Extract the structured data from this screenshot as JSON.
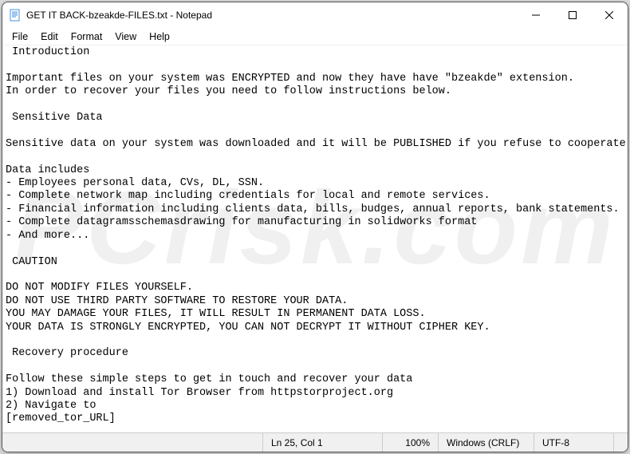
{
  "titlebar": {
    "title": "GET IT BACK-bzeakde-FILES.txt - Notepad"
  },
  "menu": {
    "file": "File",
    "edit": "Edit",
    "format": "Format",
    "view": "View",
    "help": "Help"
  },
  "content": " Introduction\n\nImportant files on your system was ENCRYPTED and now they have have \"bzeakde\" extension.\nIn order to recover your files you need to follow instructions below.\n\n Sensitive Data\n\nSensitive data on your system was downloaded and it will be PUBLISHED if you refuse to cooperate.\n\nData includes\n- Employees personal data, CVs, DL, SSN.\n- Complete network map including credentials for local and remote services.\n- Financial information including clients data, bills, budges, annual reports, bank statements.\n- Complete datagramsschemasdrawing for manufacturing in solidworks format\n- And more...\n\n CAUTION\n\nDO NOT MODIFY FILES YOURSELF.\nDO NOT USE THIRD PARTY SOFTWARE TO RESTORE YOUR DATA.\nYOU MAY DAMAGE YOUR FILES, IT WILL RESULT IN PERMANENT DATA LOSS.\nYOUR DATA IS STRONGLY ENCRYPTED, YOU CAN NOT DECRYPT IT WITHOUT CIPHER KEY.\n\n Recovery procedure\n\nFollow these simple steps to get in touch and recover your data\n1) Download and install Tor Browser from httpstorproject.org\n2) Navigate to\n[removed_tor_URL]",
  "status": {
    "linecol": "Ln 25, Col 1",
    "zoom": "100%",
    "eol": "Windows (CRLF)",
    "encoding": "UTF-8"
  },
  "watermark": "PCrisk.com"
}
